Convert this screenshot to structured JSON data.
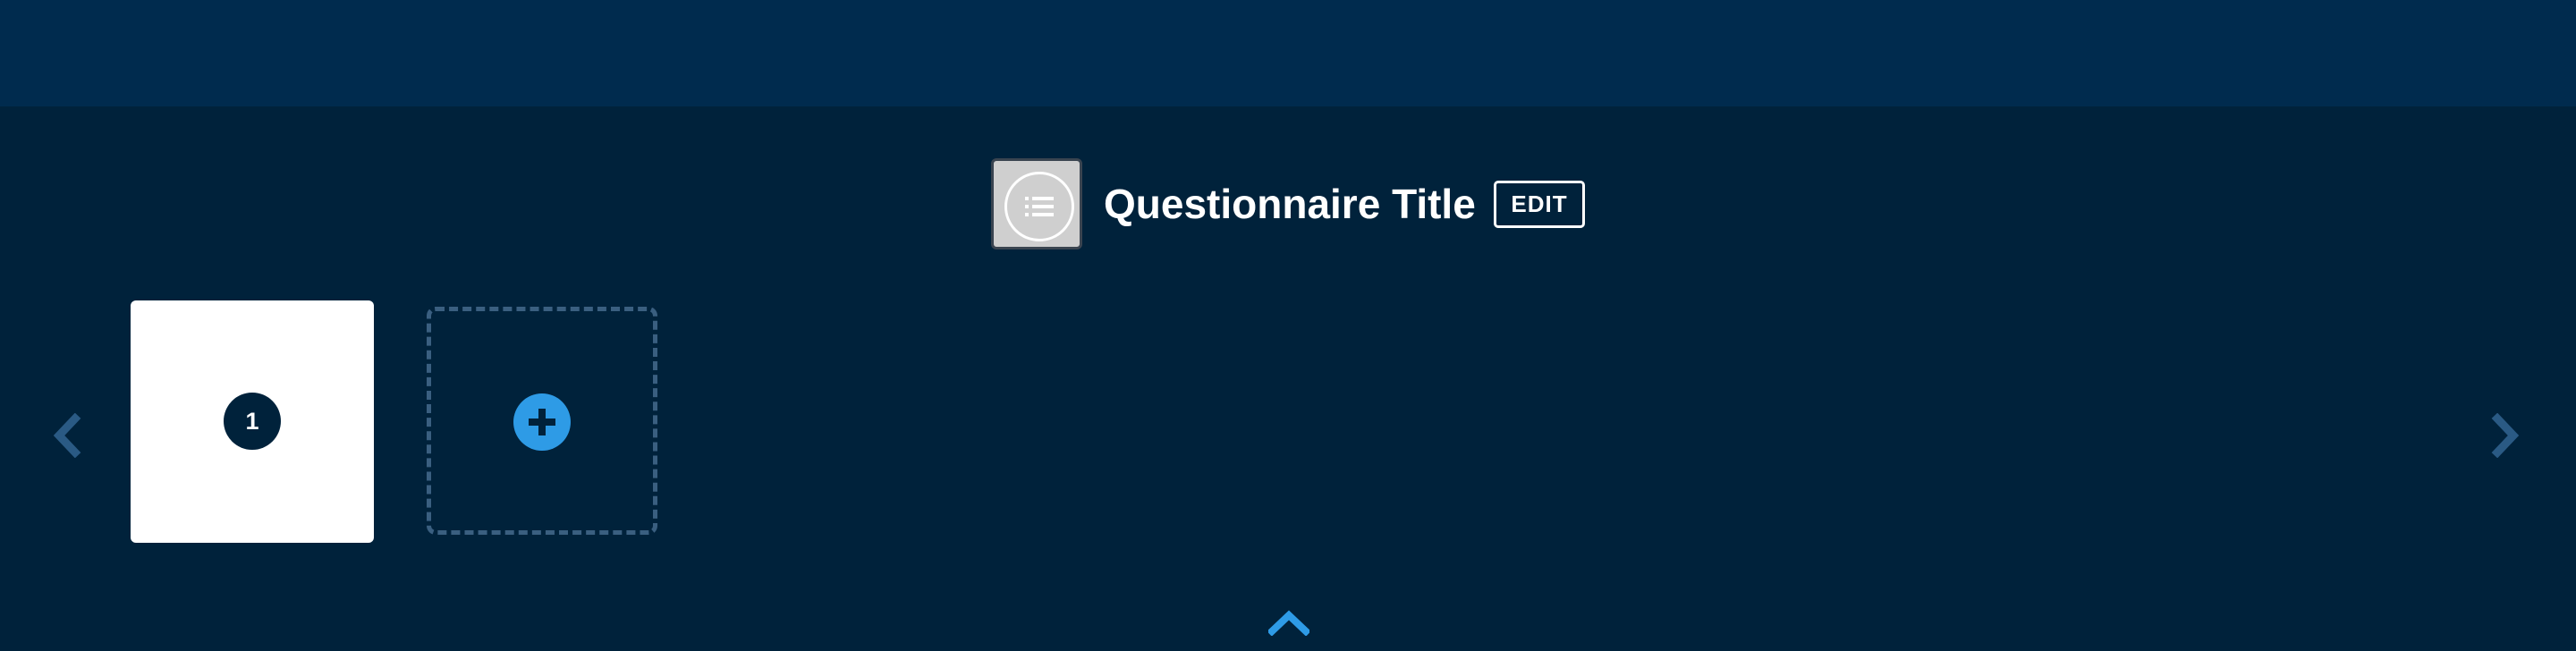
{
  "header": {
    "icon": "list-icon",
    "title": "Questionnaire Title",
    "edit_label": "EDIT"
  },
  "carousel": {
    "prev_icon": "chevron-left-icon",
    "next_icon": "chevron-right-icon",
    "pages": [
      {
        "number": "1"
      }
    ],
    "add_icon": "plus-icon"
  },
  "footer": {
    "toggle_icon": "chevron-up-icon"
  },
  "colors": {
    "top_bar": "#002b4e",
    "background": "#00223b",
    "accent": "#2e9be6",
    "arrow": "#2a5a84",
    "dashed_border": "#3a5f80"
  }
}
